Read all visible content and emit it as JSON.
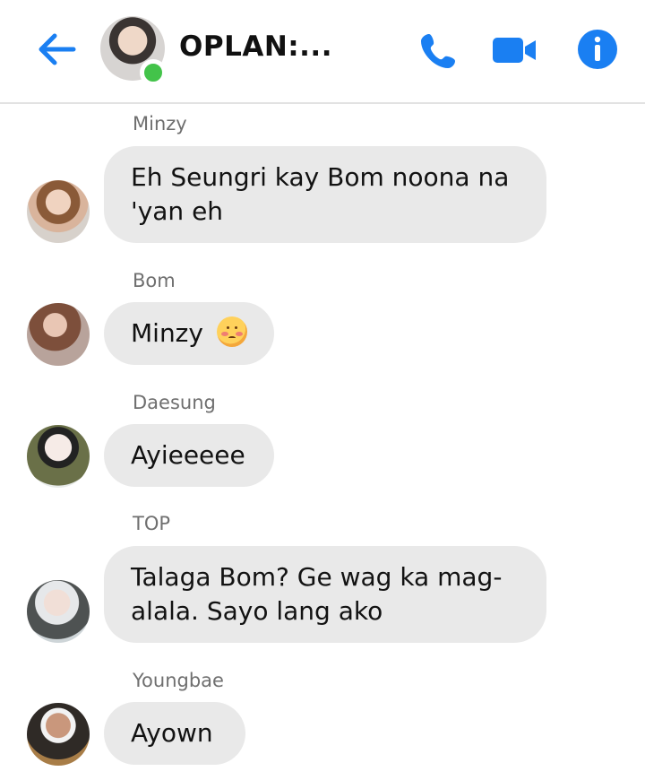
{
  "header": {
    "title": "OPLAN:...",
    "icons": {
      "back": "arrow-left-icon",
      "call": "phone-icon",
      "video": "video-camera-icon",
      "info": "info-icon"
    },
    "accent": "#1a7ff2",
    "online_color": "#43c34a"
  },
  "messages": [
    {
      "sender": "Minzy",
      "text_lines": [
        "Eh Seungri kay Bom noona na",
        "'yan eh"
      ]
    },
    {
      "sender": "Bom",
      "text": "Minzy",
      "emoji": "sad-face-emoji"
    },
    {
      "sender": "Daesung",
      "text": "Ayieeeee"
    },
    {
      "sender": "TOP",
      "text_lines": [
        "Talaga Bom? Ge wag ka mag-",
        "alala. Sayo lang ako"
      ]
    },
    {
      "sender": "Youngbae",
      "text": "Ayown"
    }
  ]
}
